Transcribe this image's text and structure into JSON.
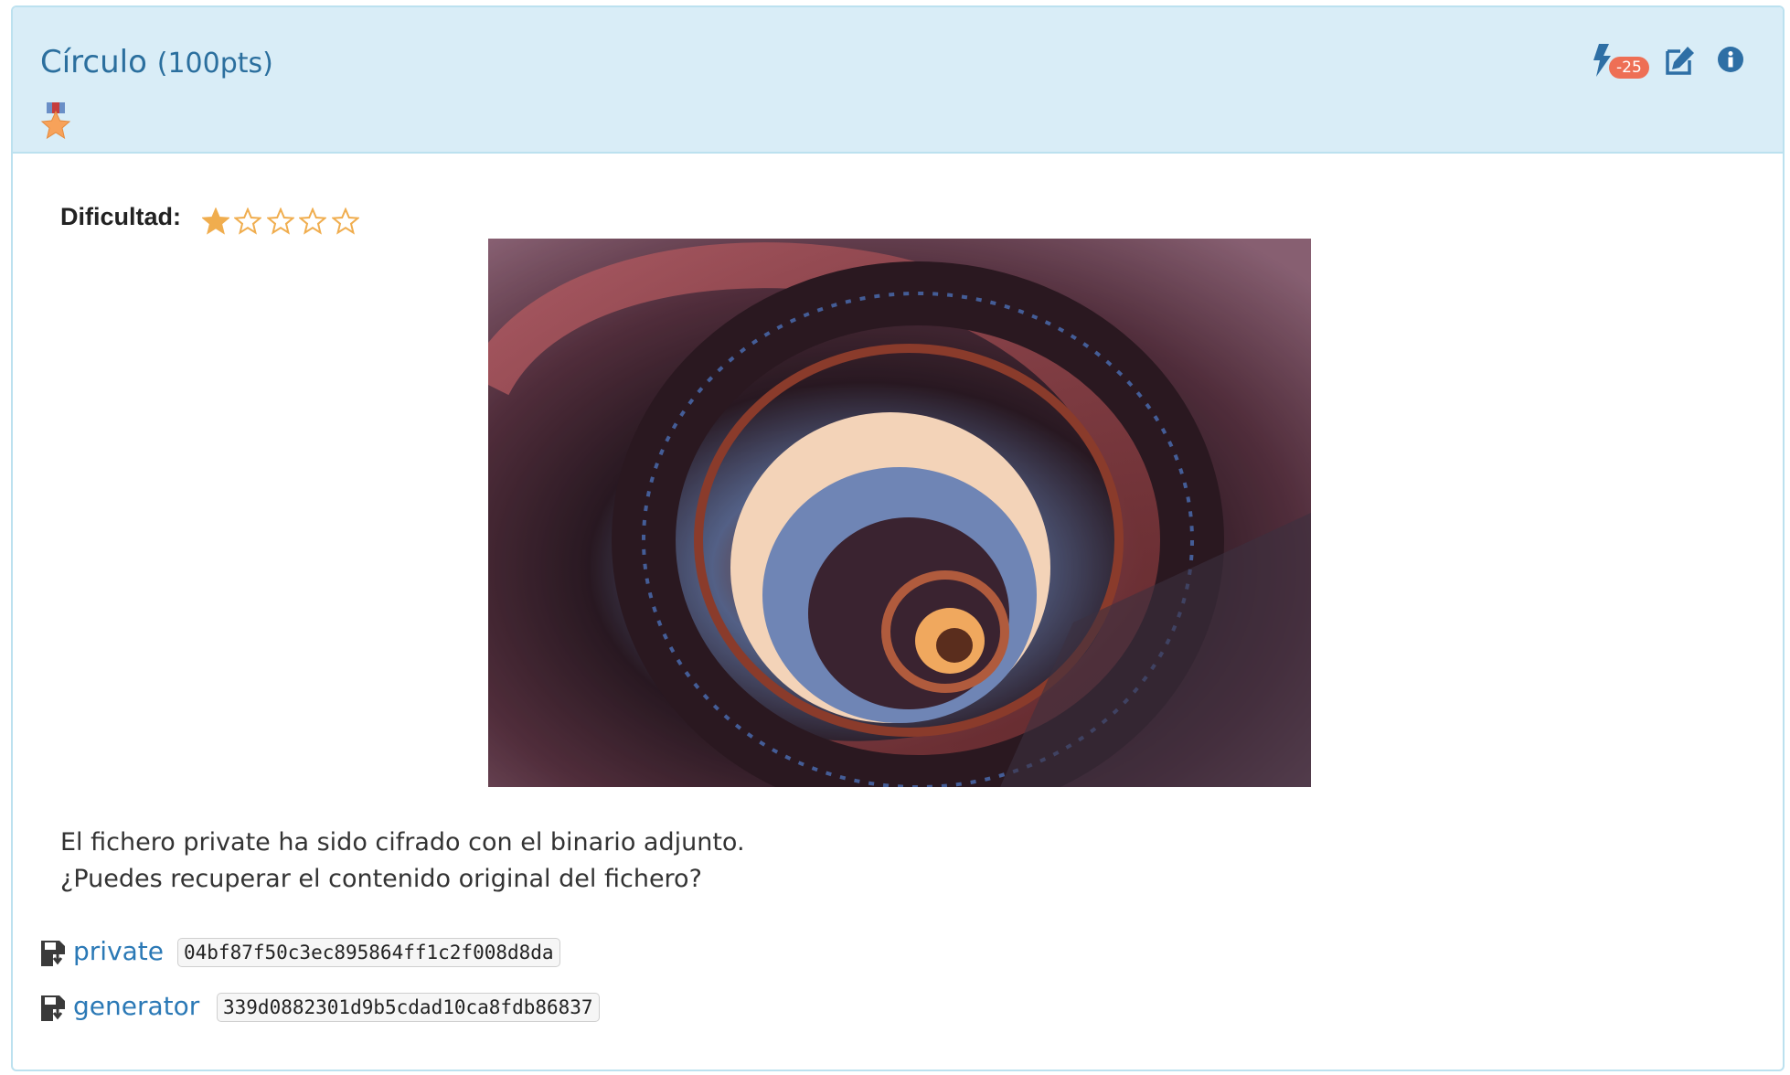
{
  "challenge": {
    "title": "Círculo",
    "points": "(100pts)",
    "penalty": "-25",
    "difficulty_label": "Dificultad:",
    "difficulty": {
      "value": 1,
      "max": 5
    },
    "description": [
      "El fichero private ha sido cifrado con el binario adjunto.",
      "¿Puedes recuperar el contenido original del fichero?"
    ],
    "files": [
      {
        "name": "private",
        "hash": "04bf87f50c3ec895864ff1c2f008d8da"
      },
      {
        "name": "generator",
        "hash": "339d0882301d9b5cdad10ca8fdb86837"
      }
    ]
  },
  "icons": {
    "medal": "medal-icon",
    "hint": "bolt-icon",
    "edit": "edit-icon",
    "info": "info-icon",
    "download": "disk-download-icon",
    "star": "star-icon"
  },
  "colors": {
    "heading_bg": "#d9edf7",
    "title": "#2b6f9e",
    "link": "#2b79b6",
    "badge": "#ee6f55",
    "star": "#f0ad4e"
  }
}
